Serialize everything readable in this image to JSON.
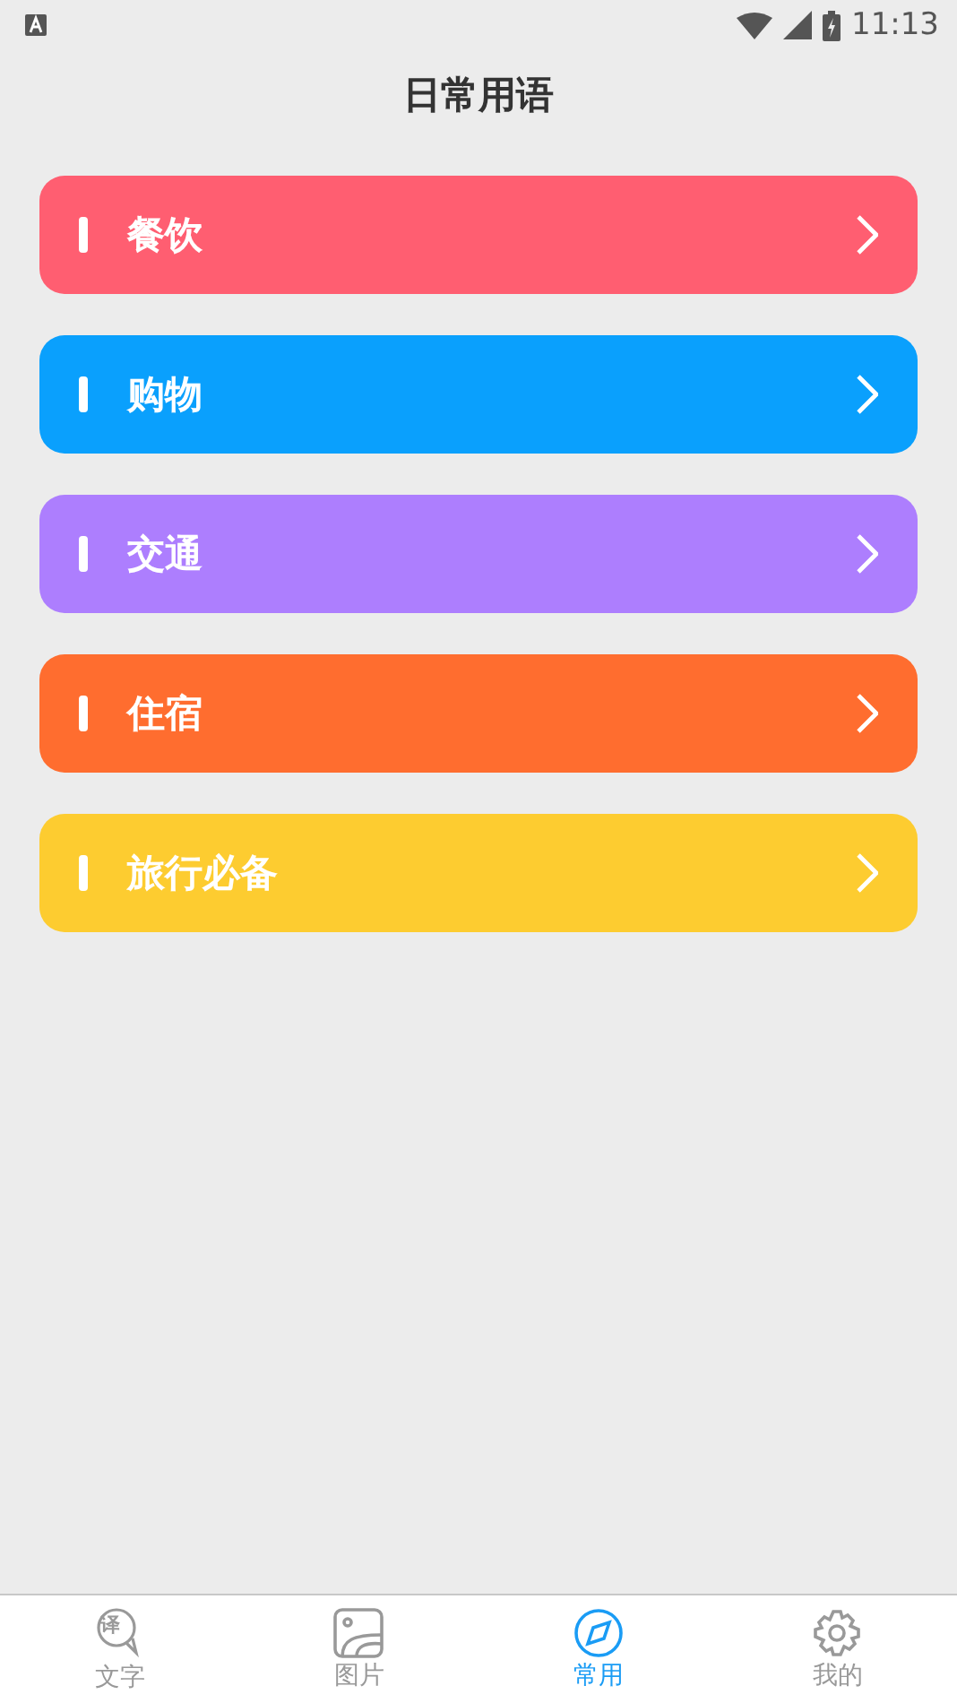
{
  "status_bar": {
    "time": "11:13"
  },
  "title": "日常用语",
  "categories": [
    {
      "label": "餐饮",
      "color": "#ff5e71"
    },
    {
      "label": "购物",
      "color": "#0aa0fd"
    },
    {
      "label": "交通",
      "color": "#ad7efe"
    },
    {
      "label": "住宿",
      "color": "#ff6d2f"
    },
    {
      "label": "旅行必备",
      "color": "#fdcc30"
    }
  ],
  "tabs": [
    {
      "label": "文字",
      "kind": "translate",
      "glyph": "译",
      "selected": false
    },
    {
      "label": "图片",
      "kind": "image",
      "selected": false
    },
    {
      "label": "常用",
      "kind": "compass",
      "selected": true
    },
    {
      "label": "我的",
      "kind": "gear",
      "selected": false
    }
  ]
}
